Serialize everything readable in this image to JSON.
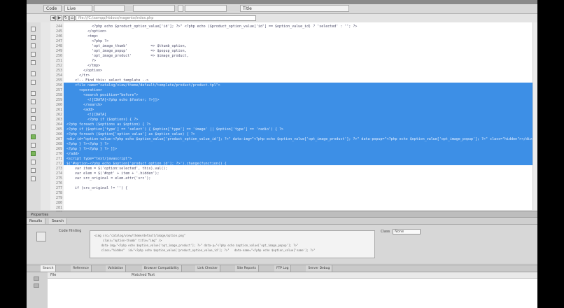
{
  "toolbar": {
    "items": [
      "Code",
      "Live",
      "",
      "",
      "",
      "",
      "Title"
    ]
  },
  "addressbar": {
    "back": "◀",
    "forward": "▶",
    "refresh": "↻",
    "home": "⌂",
    "address_placeholder": "file:///C:/xampp/htdocs/magento/index.php"
  },
  "line_numbers": [
    "244",
    "245",
    "246",
    "247",
    "248",
    "249",
    "250",
    "251",
    "252",
    "253",
    "254",
    "255",
    "256",
    "257",
    "258",
    "259",
    "260",
    "261",
    "262",
    "263",
    "264",
    "265",
    "266",
    "267",
    "268",
    "269",
    "270",
    "271",
    "272",
    "273",
    "274",
    "275",
    "276",
    "277",
    "278",
    "279",
    "280",
    "281",
    "282"
  ],
  "code_lines": [
    "            <?php echo $product_option_value['id']; ?>\" <?php echo ($product_option_value['id'] == $option_value_id) ? 'selected' : ''; ?>",
    "          </option>",
    "          <tmp>",
    "            <?php ?>",
    "            'opt_image_thumb'           => $thumb_option,",
    "            'opt_image_popup'           => $popup_option,",
    "            'opt_image_product'         => $image_product,",
    "            ?>",
    "          </tmp>",
    "        </option>",
    "      </tr>",
    "    <!-- Find this: select template -->",
    "    <file name=\"catalog/view/theme/default/template/product/product.tpl\">",
    "      <operation>",
    "        <search position=\"before\">",
    "          <![CDATA[<?php echo $footer; ?>]]>",
    "        </search>",
    "        <add>",
    "          <![CDATA[",
    "          <?php if ($options) { ?>",
    "<?php foreach ($options as $option) { ?>",
    "<?php if ($option['type'] == 'select') { $option['type'] == 'image' || $option['type'] == 'radio') { ?>",
    "<?php foreach ($option['option_value'] as $option_value) { ?>",
    "<div id=\"option-value-<?php echo $option_value['product_option_value_id']; ?>\" data-img=\"<?php echo $option_value['opt_image_product']; ?>\" data-popup=\"<?php echo $option_value['opt_image_popup']; ?>\" class=\"hidden\"></div>",
    "<?php } ?><?php } ?>",
    "<?php } ?><?php } ?> ]]>",
    "</add>",
    "<script type=\"text/javascript\">",
    "$('#option-<?php echo $option['product_option_id']; ?>').change(function() {",
    "    var item = $('option:selected', this).val();",
    "    var elem = $('#opt' + item + '.hidden');",
    "    var src_original = elem.attr('src');",
    "",
    "    if (src_original != '') {"
  ],
  "panels": {
    "properties_header": "Properties",
    "prop_tabs": [
      "Results",
      "Search"
    ],
    "prop_label_left": "Code Hinting",
    "prop_label_right": "Class",
    "prop_select": "None",
    "prop_box_lines": [
      "<img src=\"catalog/view/theme/default/image/option.png\"",
      "     class=\"option-thumb\" title=\"img\" />",
      "    data-img=\"<?php echo $option_value['opt_image_product']; ?>\" data-p=\"<?php echo $option_value['opt_image_popup']; ?>\"",
      "    class=\"hidden\"  id=\"<?php echo $option_value['product_option_value_id']; ?>\"   data-name=\"<?php echo $option_value['name']; ?>\""
    ],
    "results_tabs": [
      "Search",
      "Reference",
      "Validation",
      "Browser Compatibility",
      "Link Checker",
      "Site Reports",
      "FTP Log",
      "Server Debug"
    ],
    "results_columns": [
      "File",
      "Matched Text"
    ]
  }
}
